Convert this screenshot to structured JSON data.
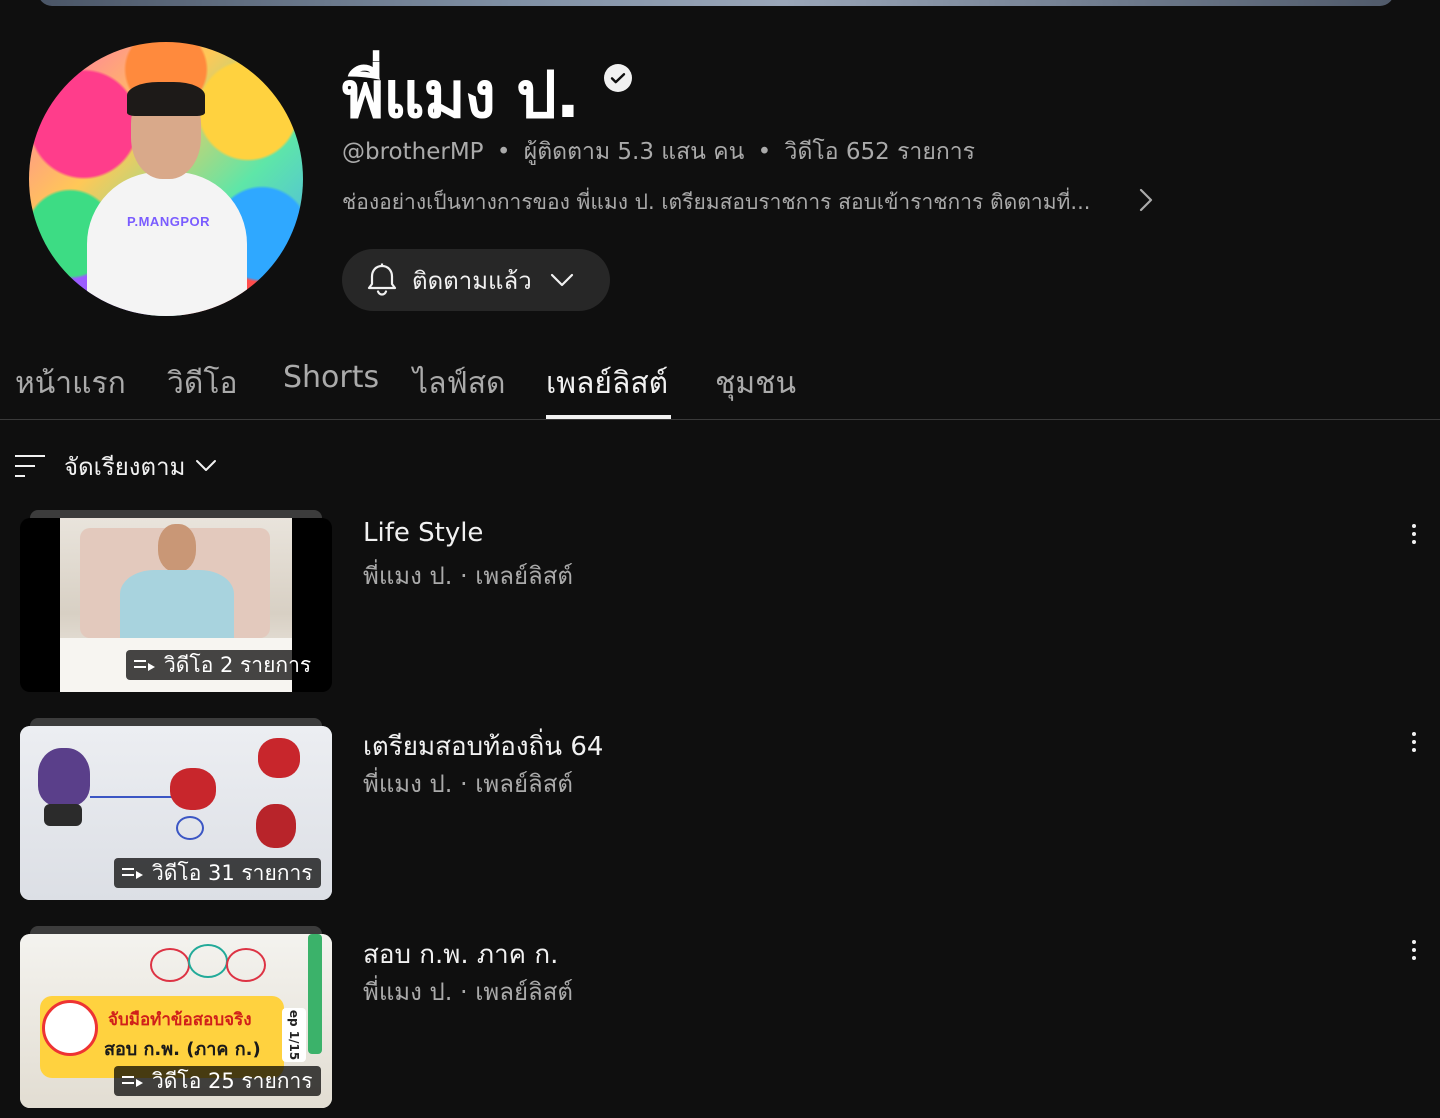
{
  "channel": {
    "name": "พี่แมง ป.",
    "handle": "@brotherMP",
    "subscribers": "ผู้ติดตาม 5.3 แสน คน",
    "video_count": "วิดีโอ 652 รายการ",
    "separator": "•",
    "description": "ช่องอย่างเป็นทางการของ พี่แมง ป. เตรียมสอบราชการ สอบเข้าราชการ ติดตามที่...",
    "avatar_shirt_text": "P.MANGPOR",
    "subscribe_label": "ติดตามแล้ว"
  },
  "tabs": [
    {
      "label": "หน้าแรก"
    },
    {
      "label": "วิดีโอ"
    },
    {
      "label": "Shorts"
    },
    {
      "label": "ไลฟ์สด"
    },
    {
      "label": "เพลย์ลิสต์"
    },
    {
      "label": "ชุมชน"
    }
  ],
  "active_tab": "เพลย์ลิสต์",
  "sort": {
    "label": "จัดเรียงตาม"
  },
  "playlists": [
    {
      "title": "Life Style",
      "subtitle": "พี่แมง ป. · เพลย์ลิสต์",
      "count": "วิดีโอ 2 รายการ"
    },
    {
      "title": "เตรียมสอบท้องถิ่น 64",
      "subtitle": "พี่แมง ป. · เพลย์ลิสต์",
      "count": "วิดีโอ 31 รายการ"
    },
    {
      "title": "สอบ ก.พ. ภาค ก.",
      "subtitle": "พี่แมง ป. · เพลย์ลิสต์",
      "count": "วิดีโอ 25 รายการ"
    }
  ],
  "thumb3_text": {
    "line1": "จับมือทำข้อสอบจริง",
    "line2": "สอบ ก.พ. (ภาค ก.)",
    "tag": "ep 1/15"
  },
  "icons": {
    "verified": "verified-check-icon",
    "bell": "bell-icon",
    "sort": "sort-lines-icon",
    "playlist": "playlist-play-icon",
    "more": "more-vert-icon"
  }
}
